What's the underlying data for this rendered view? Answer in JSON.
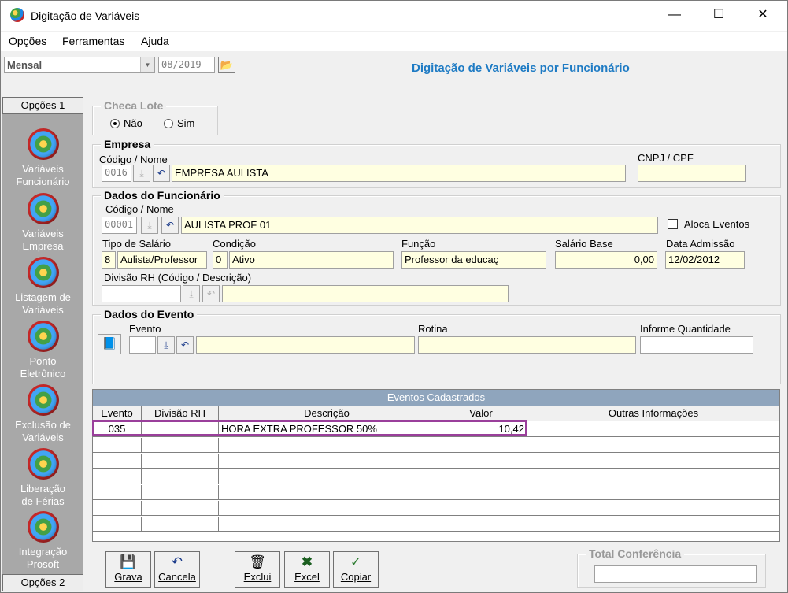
{
  "window": {
    "title": "Digitação de Variáveis",
    "minimize": "—",
    "maximize": "☐",
    "close": "✕"
  },
  "menu": [
    "Opções",
    "Ferramentas",
    "Ajuda"
  ],
  "toolbar": {
    "period_type": "Mensal",
    "period": "08/2019",
    "page_title": "Digitação de Variáveis por Funcionário"
  },
  "sidebar": {
    "top_header": "Opções 1",
    "bottom_header": "Opções 2",
    "items": [
      {
        "l1": "Variáveis",
        "l2": "Funcionário"
      },
      {
        "l1": "Variáveis",
        "l2": "Empresa"
      },
      {
        "l1": "Listagem de",
        "l2": "Variáveis"
      },
      {
        "l1": "Ponto",
        "l2": "Eletrônico"
      },
      {
        "l1": "Exclusão de",
        "l2": "Variáveis"
      },
      {
        "l1": "Liberação",
        "l2": "de Férias"
      },
      {
        "l1": "Integração",
        "l2": "Prosoft"
      }
    ]
  },
  "checa_lote": {
    "legend": "Checa Lote",
    "opt_nao": "Não",
    "opt_sim": "Sim"
  },
  "empresa": {
    "legend": "Empresa",
    "codigo_label": "Código / Nome",
    "codigo": "0016",
    "nome": "EMPRESA AULISTA",
    "cnpj_label": "CNPJ / CPF",
    "cnpj": ""
  },
  "funcionario": {
    "legend": "Dados do Funcionário",
    "codigo_label": "Código / Nome",
    "codigo": "00001",
    "nome": "AULISTA PROF 01",
    "aloca_label": "Aloca Eventos",
    "tipo_label": "Tipo de Salário",
    "tipo_cod": "8",
    "tipo_desc": "Aulista/Professor",
    "cond_label": "Condição",
    "cond_cod": "0",
    "cond_desc": "Ativo",
    "funcao_label": "Função",
    "funcao": "Professor da  educaç",
    "salario_label": "Salário Base",
    "salario": "0,00",
    "admissao_label": "Data Admissão",
    "admissao": "12/02/2012",
    "divisao_label": "Divisão RH (Código / Descrição)"
  },
  "evento": {
    "legend": "Dados do Evento",
    "evento_label": "Evento",
    "rotina_label": "Rotina",
    "quantidade_label": "Informe Quantidade"
  },
  "grid": {
    "caption": "Eventos Cadastrados",
    "headers": [
      "Evento",
      "Divisão RH",
      "Descrição",
      "Valor",
      "Outras Informações"
    ],
    "rows": [
      {
        "evento": "035",
        "divisao": "",
        "descricao": "HORA EXTRA PROFESSOR 50%",
        "valor": "10,42",
        "outras": ""
      }
    ]
  },
  "buttons": {
    "grava": "Grava",
    "cancela": "Cancela",
    "exclui": "Exclui",
    "excel": "Excel",
    "copiar": "Copiar"
  },
  "total": {
    "legend": "Total Conferência",
    "value": ""
  },
  "colors": {
    "title_blue": "#1e7bc4",
    "field_yellow": "#ffffe1",
    "highlight": "#9a3f9b",
    "sidebar": "#a8a8a8"
  }
}
